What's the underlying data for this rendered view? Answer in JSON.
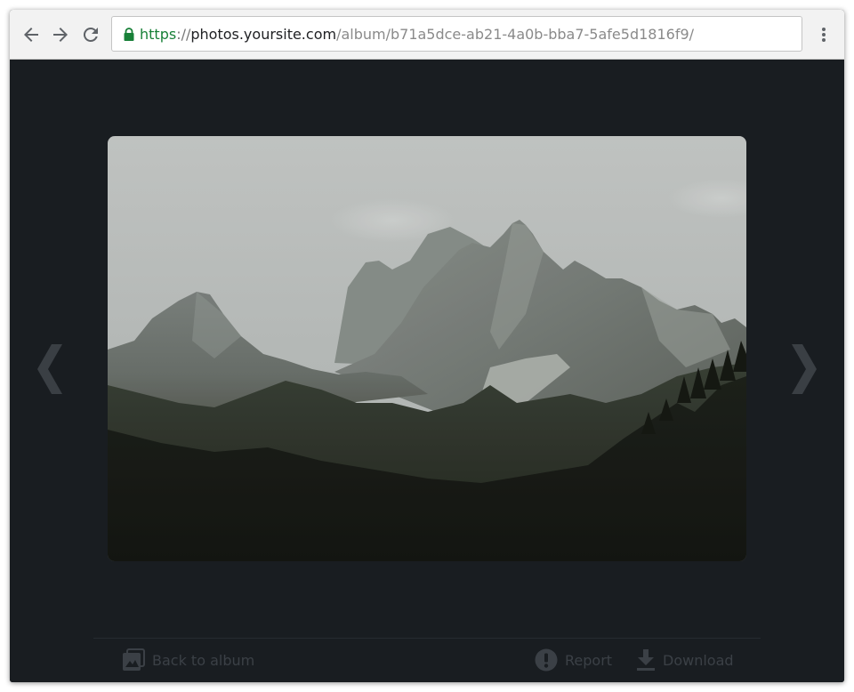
{
  "browser": {
    "nav": {
      "back_icon": "arrow-left-icon",
      "forward_icon": "arrow-right-icon",
      "reload_icon": "reload-icon",
      "menu_icon": "kebab-menu-icon"
    },
    "address_bar": {
      "secure_icon": "lock-icon",
      "scheme": "https",
      "separator": "://",
      "host": "photos.yoursite.com",
      "path": "/album/b71a5dce-ab21-4a0b-bba7-5afe5d1816f9/"
    },
    "colors": {
      "scheme": "#188038",
      "host": "#202124",
      "path": "#8a8a8a"
    }
  },
  "viewer": {
    "background": "#191d21",
    "photo": {
      "subject": "rocky mountain peaks over dark pine forest under overcast sky"
    },
    "prev_icon": "chevron-left-icon",
    "next_icon": "chevron-right-icon",
    "footer": {
      "back_to_album": {
        "label": "Back to album",
        "icon": "photo-album-icon"
      },
      "report": {
        "label": "Report",
        "icon": "alert-circle-icon"
      },
      "download": {
        "label": "Download",
        "icon": "download-icon"
      },
      "text_color": "#3b4046"
    }
  }
}
